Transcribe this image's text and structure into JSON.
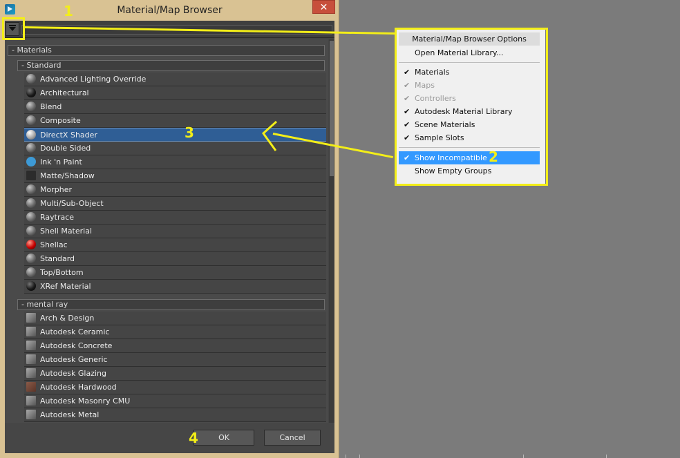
{
  "window": {
    "title": "Material/Map Browser",
    "close_label": "✕"
  },
  "groups": {
    "materials": "- Materials",
    "standard": "- Standard",
    "mental_ray": "- mental ray"
  },
  "standard_items": [
    {
      "label": "Advanced Lighting Override",
      "swatch": "gray-sphere"
    },
    {
      "label": "Architectural",
      "swatch": "dark-sphere"
    },
    {
      "label": "Blend",
      "swatch": "gray-sphere"
    },
    {
      "label": "Composite",
      "swatch": "gray-sphere"
    },
    {
      "label": "DirectX Shader",
      "swatch": "light-sphere",
      "selected": true
    },
    {
      "label": "Double Sided",
      "swatch": "gray-sphere"
    },
    {
      "label": "Ink 'n Paint",
      "swatch": "blue-circle"
    },
    {
      "label": "Matte/Shadow",
      "swatch": "dark-square"
    },
    {
      "label": "Morpher",
      "swatch": "gray-sphere"
    },
    {
      "label": "Multi/Sub-Object",
      "swatch": "gray-sphere"
    },
    {
      "label": "Raytrace",
      "swatch": "gray-sphere"
    },
    {
      "label": "Shell Material",
      "swatch": "gray-sphere"
    },
    {
      "label": "Shellac",
      "swatch": "red-sphere"
    },
    {
      "label": "Standard",
      "swatch": "gray-sphere"
    },
    {
      "label": "Top/Bottom",
      "swatch": "gray-sphere"
    },
    {
      "label": "XRef Material",
      "swatch": "dark-sphere"
    }
  ],
  "mental_ray_items": [
    {
      "label": "Arch & Design",
      "swatch": "gray-square"
    },
    {
      "label": "Autodesk Ceramic",
      "swatch": "gray-square"
    },
    {
      "label": "Autodesk Concrete",
      "swatch": "gray-square"
    },
    {
      "label": "Autodesk Generic",
      "swatch": "gray-square"
    },
    {
      "label": "Autodesk Glazing",
      "swatch": "gray-square"
    },
    {
      "label": "Autodesk Hardwood",
      "swatch": "brown-square"
    },
    {
      "label": "Autodesk Masonry CMU",
      "swatch": "gray-square"
    },
    {
      "label": "Autodesk Metal",
      "swatch": "gray-square"
    }
  ],
  "footer": {
    "ok_label": "OK",
    "cancel_label": "Cancel"
  },
  "options_menu": {
    "header": "Material/Map Browser Options",
    "open_library": "Open Material Library...",
    "items": [
      {
        "label": "Materials",
        "checked": true,
        "enabled": true
      },
      {
        "label": "Maps",
        "checked": true,
        "enabled": false
      },
      {
        "label": "Controllers",
        "checked": true,
        "enabled": false
      },
      {
        "label": "Autodesk Material Library",
        "checked": true,
        "enabled": true
      },
      {
        "label": "Scene Materials",
        "checked": true,
        "enabled": true
      },
      {
        "label": "Sample Slots",
        "checked": true,
        "enabled": true
      }
    ],
    "show_incompatible": "Show Incompatible",
    "show_empty_groups": "Show Empty Groups"
  },
  "annotations": {
    "m1": "1",
    "m2": "2",
    "m3": "3",
    "m4": "4",
    "color": "#f3ee18"
  },
  "colors": {
    "selection": "#2f5e95",
    "menu_hover": "#3399ff",
    "close": "#c74f3c"
  }
}
